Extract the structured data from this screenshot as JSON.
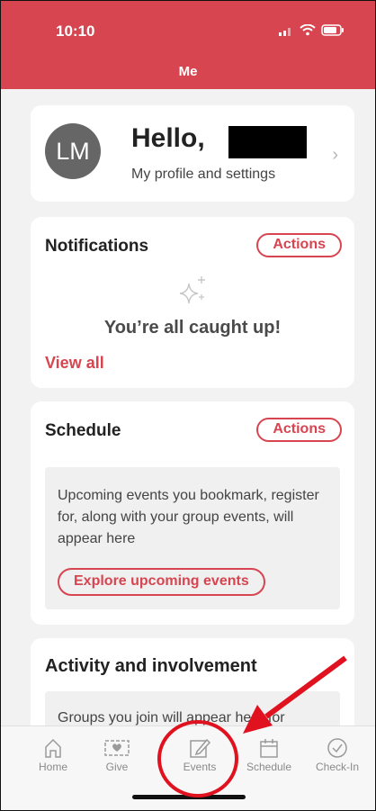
{
  "status_bar": {
    "time": "10:10"
  },
  "header": {
    "title": "Me"
  },
  "profile": {
    "initials": "LM",
    "greeting": "Hello,",
    "subtitle": "My profile and settings"
  },
  "notifications": {
    "title": "Notifications",
    "actions_label": "Actions",
    "empty_message": "You’re all caught up!",
    "view_all_label": "View all"
  },
  "schedule": {
    "title": "Schedule",
    "actions_label": "Actions",
    "empty_message": "Upcoming events you bookmark, register for, along with your group events, will appear here",
    "explore_label": "Explore upcoming events"
  },
  "activity": {
    "title": "Activity and involvement",
    "empty_message": "Groups you join will appear here for"
  },
  "tabbar": {
    "items": [
      {
        "label": "Home",
        "icon": "home-icon"
      },
      {
        "label": "Give",
        "icon": "give-icon"
      },
      {
        "label": "Events",
        "icon": "edit-icon"
      },
      {
        "label": "Schedule",
        "icon": "calendar-icon"
      },
      {
        "label": "Check-In",
        "icon": "check-circle-icon"
      }
    ]
  },
  "colors": {
    "brand": "#d64550",
    "annotation": "#e0121f"
  }
}
